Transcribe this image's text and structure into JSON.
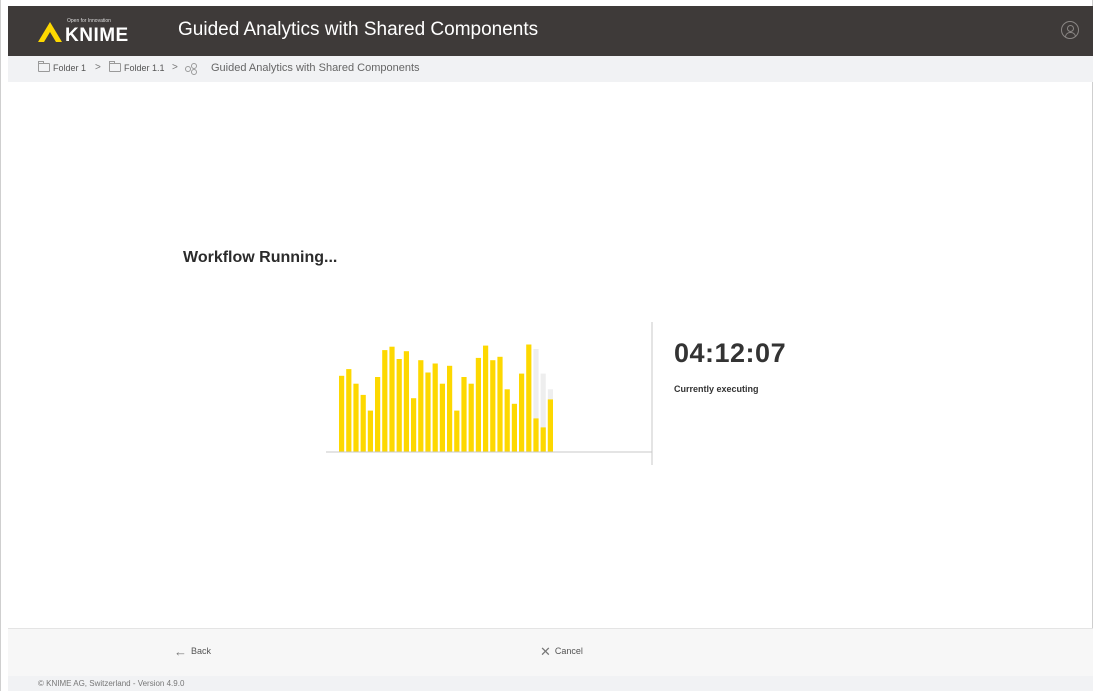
{
  "header": {
    "logo_tagline": "Open for Innovation",
    "logo_text": "KNIME",
    "title": "Guided Analytics with Shared Components",
    "brand_color": "#fdd800",
    "bar_color": "#3e3a39"
  },
  "breadcrumb": {
    "items": [
      "Folder 1",
      "Folder 1.1"
    ],
    "separator": ">",
    "current": "Guided Analytics with Shared Components"
  },
  "main": {
    "status_title": "Workflow Running...",
    "timer": "04:12:07",
    "execution_status": "Currently executing"
  },
  "chart_data": {
    "type": "bar",
    "values": [
      68,
      74,
      61,
      51,
      37,
      67,
      91,
      94,
      83,
      90,
      48,
      82,
      71,
      79,
      61,
      77,
      37,
      67,
      61,
      84,
      95,
      82,
      85,
      56,
      43,
      70,
      96,
      30,
      22,
      47
    ],
    "pending_values": [
      92,
      70,
      56
    ],
    "color": "#fdd800",
    "pending_color": "#eeeeee"
  },
  "footer": {
    "back_label": "Back",
    "cancel_label": "Cancel",
    "copyright": "© KNIME AG, Switzerland - Version 4.9.0"
  }
}
